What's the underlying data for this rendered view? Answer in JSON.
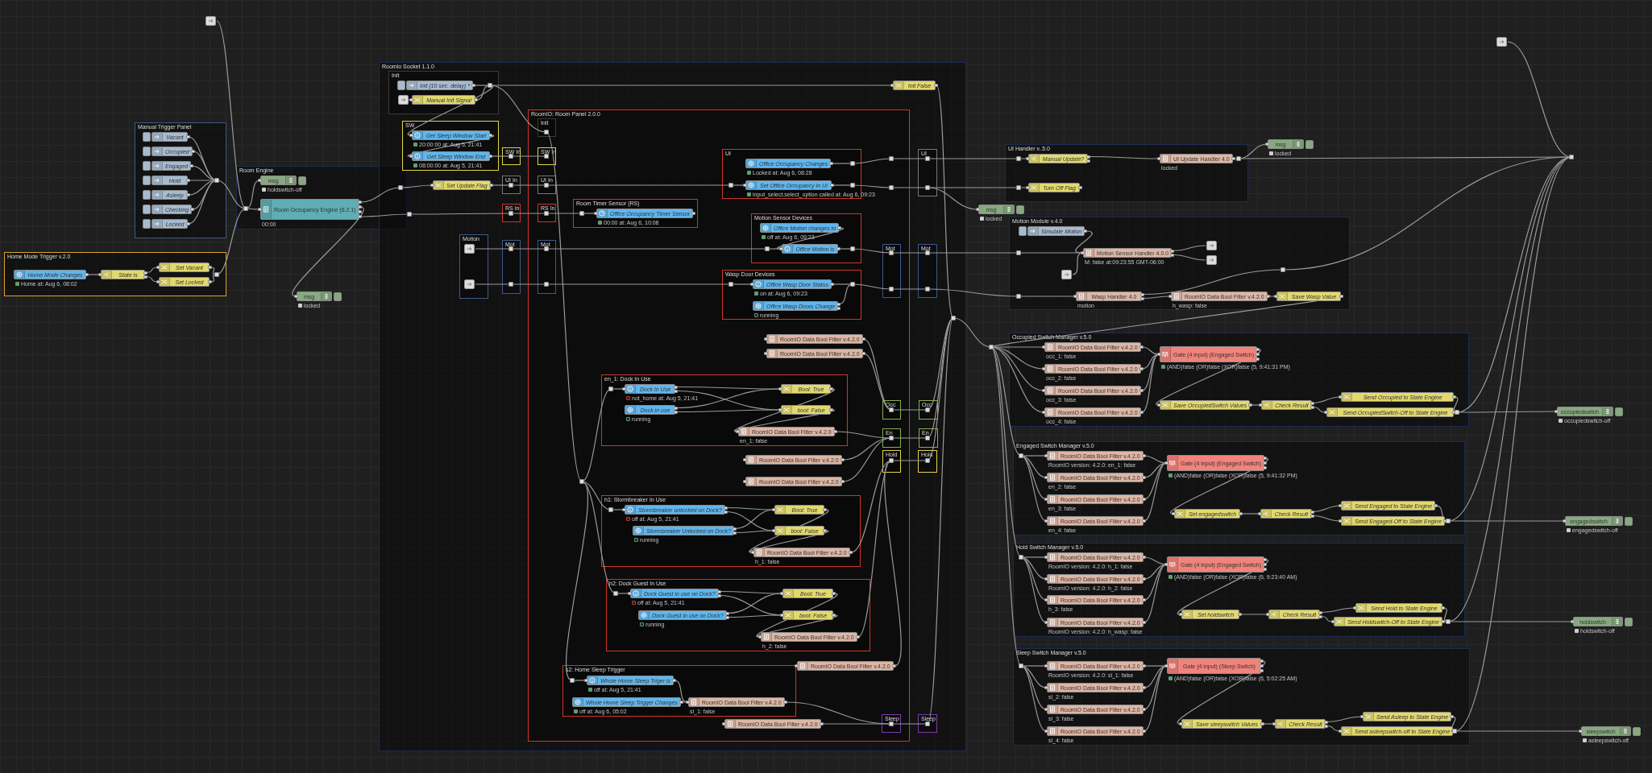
{
  "flow": {
    "nodes": [
      {
        "kind": "debug",
        "label": "msg",
        "status": {
          "text": "locked",
          "color": "#cccccc",
          "hollow": false
        }
      },
      {
        "kind": "debug",
        "label": "msg",
        "status": {
          "text": "locked",
          "color": "#cccccc",
          "hollow": false
        }
      },
      {
        "kind": "debug",
        "label": "msg",
        "status": {
          "text": "locked",
          "color": "#cccccc",
          "hollow": false
        }
      },
      {
        "kind": "debug",
        "label": "occupiedswitch",
        "status": {
          "text": "occupiedswitch-off",
          "color": "#cccccc",
          "hollow": false
        }
      },
      {
        "kind": "debug",
        "label": "engagedswitch",
        "status": {
          "text": "engagedswitch-off",
          "color": "#cccccc",
          "hollow": false
        }
      },
      {
        "kind": "debug",
        "label": "holdswitch",
        "status": {
          "text": "holdswitch-off",
          "color": "#cccccc",
          "hollow": false
        }
      },
      {
        "kind": "debug",
        "label": "sleepswitch",
        "status": {
          "text": "asleepswitch-off",
          "color": "#cccccc",
          "hollow": false
        }
      }
    ],
    "groups": [
      {
        "title": "Manual Trigger Panel",
        "color": "#3d5a8a",
        "nodes": [
          {
            "kind": "inject",
            "label": "Vacant"
          },
          {
            "kind": "inject",
            "label": "Occupied"
          },
          {
            "kind": "inject",
            "label": "Engaged"
          },
          {
            "kind": "inject",
            "label": "Hold"
          },
          {
            "kind": "inject",
            "label": "Asleep"
          },
          {
            "kind": "inject",
            "label": "Checking"
          },
          {
            "kind": "inject",
            "label": "Locked"
          }
        ]
      },
      {
        "title": "Home Mode Trigger v.2.0",
        "color": "#d9a52a",
        "nodes": [
          {
            "kind": "ha-event",
            "label": "Home Mode Changes",
            "status": {
              "text": "Home at: Aug 6, 08:02",
              "color": "#5aa06e",
              "hollow": false
            }
          },
          {
            "kind": "switch",
            "label": "State is"
          },
          {
            "kind": "change",
            "label": "Set Vacant"
          },
          {
            "kind": "change",
            "label": "Set Locked"
          }
        ]
      },
      {
        "title": "Room Engine",
        "color": "#1d2b4f",
        "nodes": [
          {
            "kind": "debug",
            "label": "msg",
            "status": {
              "text": "holdswitch-off",
              "color": "#cccccc",
              "hollow": false
            }
          },
          {
            "kind": "engine",
            "label": "Room Occupancy Engine (6.2.1)",
            "status": {
              "text": "00:00"
            }
          }
        ]
      },
      {
        "title": "Roomio Socket 1.1.0",
        "color": "#1d2b55",
        "nodes": [
          {
            "kind": "change",
            "label": "Set Update Flag"
          },
          {
            "kind": "change",
            "label": "Init False"
          }
        ],
        "groups": [
          {
            "title": "Init",
            "color": "#3a3a3a",
            "nodes": [
              {
                "kind": "inject",
                "label": "Init (10 sec. delay) *"
              },
              {
                "kind": "change",
                "label": "Manual Init Signal"
              }
            ]
          },
          {
            "title": "SW",
            "color": "#e2d64a",
            "nodes": [
              {
                "kind": "ha-state",
                "label": "Get Sleep Window Start",
                "status": {
                  "text": "20:00:00 at: Aug 5, 21:41",
                  "color": "#5aa06e",
                  "hollow": false
                }
              },
              {
                "kind": "ha-state",
                "label": "Get Sleep Window End",
                "status": {
                  "text": "08:00:00 at: Aug 5, 21:41",
                  "color": "#5aa06e",
                  "hollow": false
                }
              }
            ]
          },
          {
            "title": "SW In",
            "color": "#e2d64a"
          },
          {
            "title": "UI In",
            "color": "#777777"
          },
          {
            "title": "RS In",
            "color": "#d0342a"
          },
          {
            "title": "Motion",
            "color": "#3d5a8a"
          },
          {
            "title": "Mot",
            "color": "#3d5a8a"
          },
          {
            "title": "RoomIO: Room Panel 2.0.0",
            "color": "#d0342a",
            "nodes": [
              {
                "kind": "function",
                "label": "RoomIO Data Bool Filter v.4.2.0"
              },
              {
                "kind": "function",
                "label": "RoomIO Data Bool Filter v.4.2.0"
              },
              {
                "kind": "function",
                "label": "RoomIO Data Bool Filter v.4.2.0"
              },
              {
                "kind": "function",
                "label": "RoomIO Data Bool Filter v.4.2.0"
              },
              {
                "kind": "function",
                "label": "RoomIO Data Bool Filter v.4.2.0"
              },
              {
                "kind": "function",
                "label": "RoomIO Data Bool Filter v.4.2.0"
              }
            ],
            "groups": [
              {
                "title": "Init",
                "color": "#3a3a3a"
              },
              {
                "title": "SW In",
                "color": "#e2d64a"
              },
              {
                "title": "UI In",
                "color": "#777777"
              },
              {
                "title": "RS In",
                "color": "#d0342a"
              },
              {
                "title": "Mot",
                "color": "#3d5a8a"
              },
              {
                "title": "UI",
                "color": "#d0342a",
                "nodes": [
                  {
                    "kind": "ha-event",
                    "label": "Office Occupancy Changes",
                    "status": {
                      "text": "Locked at: Aug 6, 08:28",
                      "color": "#5aa06e",
                      "hollow": false
                    }
                  },
                  {
                    "kind": "ha-action",
                    "label": "Set Office Occupancy in UI",
                    "status": {
                      "text": "input_select.select_option called at: Aug 6, 09:23",
                      "color": "#5aa06e",
                      "hollow": false
                    }
                  }
                ]
              },
              {
                "title": "Room Timer Sensor (RS)",
                "color": "#d0342a",
                "nodes": [
                  {
                    "kind": "ha-timer",
                    "label": "Office Occupancy Timer Sensor",
                    "status": {
                      "text": "00:00 at: Aug 6, 10:08",
                      "color": "#5aa06e",
                      "hollow": false
                    }
                  }
                ]
              },
              {
                "title": "Motion Sensor Devices",
                "color": "#d0342a",
                "nodes": [
                  {
                    "kind": "ha-event",
                    "label": "Office Motion changes to",
                    "status": {
                      "text": "off at: Aug 6, 09:23",
                      "color": "#5aa06e",
                      "hollow": false
                    }
                  },
                  {
                    "kind": "ha-state",
                    "label": "Office Motion is"
                  }
                ]
              },
              {
                "title": "Wasp Door Devices",
                "color": "#d0342a",
                "nodes": [
                  {
                    "kind": "ha-state",
                    "label": "Office Wasp Door Status",
                    "status": {
                      "text": "on at: Aug 6, 09:23",
                      "color": "#5aa06e",
                      "hollow": false
                    }
                  },
                  {
                    "kind": "ha-event",
                    "label": "Office Wasp Doors Change",
                    "status": {
                      "text": "running",
                      "color": "#5aa06e",
                      "hollow": true
                    }
                  }
                ]
              },
              {
                "title": "en_1: Dock In Use",
                "color": "#d0342a",
                "nodes": [
                  {
                    "kind": "ha-state",
                    "label": "Dock In Use",
                    "status": {
                      "text": "not_home at: Aug 5, 21:41",
                      "color": "#c8342c",
                      "hollow": true
                    }
                  },
                  {
                    "kind": "ha-event",
                    "label": "Dock in use",
                    "status": {
                      "text": "running",
                      "color": "#5aa06e",
                      "hollow": true
                    }
                  },
                  {
                    "kind": "change",
                    "label": "Bool: True"
                  },
                  {
                    "kind": "change",
                    "label": "bool: False"
                  },
                  {
                    "kind": "function",
                    "label": "RoomIO Data Bool Filter v.4.2.0",
                    "status": {
                      "text": "en_1: false"
                    }
                  }
                ]
              },
              {
                "title": "h1: Stormbreaker In Use",
                "color": "#d0342a",
                "nodes": [
                  {
                    "kind": "ha-state",
                    "label": "Stormbreaker unlocked on Dock?",
                    "status": {
                      "text": "off at: Aug 5, 21:41",
                      "color": "#c8342c",
                      "hollow": true
                    }
                  },
                  {
                    "kind": "ha-event",
                    "label": "Stormbreaker Unlocked on Dock?",
                    "status": {
                      "text": "running",
                      "color": "#5aa06e",
                      "hollow": true
                    }
                  },
                  {
                    "kind": "change",
                    "label": "Bool: True"
                  },
                  {
                    "kind": "change",
                    "label": "bool: False"
                  },
                  {
                    "kind": "function",
                    "label": "RoomIO Data Bool Filter v.4.2.0",
                    "status": {
                      "text": "h_1: false"
                    }
                  }
                ]
              },
              {
                "title": "h2: Dock Guest In Use",
                "color": "#d0342a",
                "nodes": [
                  {
                    "kind": "ha-state",
                    "label": "Dock Guest in use on Dock?",
                    "status": {
                      "text": "off at: Aug 5, 21:41",
                      "color": "#c8342c",
                      "hollow": true
                    }
                  },
                  {
                    "kind": "ha-event",
                    "label": "Dock Guest in use on Dock?",
                    "status": {
                      "text": "running",
                      "color": "#5aa06e",
                      "hollow": true
                    }
                  },
                  {
                    "kind": "change",
                    "label": "Bool: True"
                  },
                  {
                    "kind": "change",
                    "label": "bool: False"
                  },
                  {
                    "kind": "function",
                    "label": "RoomIO Data Bool Filter v.4.2.0",
                    "status": {
                      "text": "h_2: false"
                    }
                  }
                ]
              },
              {
                "title": "s2: Home Sleep Trigger",
                "color": "#d0342a",
                "nodes": [
                  {
                    "kind": "ha-state",
                    "label": "Whole Home Sleep Triger is",
                    "status": {
                      "text": "off at: Aug 5, 21:41",
                      "color": "#5aa06e",
                      "hollow": false
                    }
                  },
                  {
                    "kind": "ha-event",
                    "label": "Whole Home Sleep Trigger Changes",
                    "status": {
                      "text": "off at: Aug 6, 05:02",
                      "color": "#5aa06e",
                      "hollow": false
                    }
                  },
                  {
                    "kind": "function",
                    "label": "RoomIO Data Bool Filter v.4.2.0",
                    "status": {
                      "text": "sl_1: false"
                    }
                  }
                ]
              },
              {
                "title": "Mot",
                "color": "#3d5a8a"
              },
              {
                "title": "Occ",
                "color": "#8ab04a"
              },
              {
                "title": "En",
                "color": "#8ab04a"
              },
              {
                "title": "Hold",
                "color": "#e2d64a"
              },
              {
                "title": "Sleep",
                "color": "#7a3cb0"
              }
            ]
          },
          {
            "title": "UI",
            "color": "#777777"
          },
          {
            "title": "Mot",
            "color": "#3d5a8a"
          },
          {
            "title": "Occ",
            "color": "#8ab04a"
          },
          {
            "title": "En",
            "color": "#8ab04a"
          },
          {
            "title": "Hold",
            "color": "#e2d64a"
          },
          {
            "title": "Sleep",
            "color": "#7a3cb0"
          }
        ]
      },
      {
        "title": "UI Handler v..5.0",
        "color": "#1d2b55",
        "nodes": [
          {
            "kind": "switch",
            "label": "Manual Update?"
          },
          {
            "kind": "function",
            "label": "UI Update Handler 4.0",
            "status": {
              "text": "locked"
            }
          },
          {
            "kind": "change",
            "label": "Turn Off Flag"
          }
        ]
      },
      {
        "title": "Motion Module v.4.0",
        "color": "#1d2b55",
        "nodes": [
          {
            "kind": "inject",
            "label": "Simulate Motion"
          },
          {
            "kind": "function",
            "label": "Motion Sensor Handler 4.0.0",
            "status": {
              "text": "M: false at:09:23:55 GMT-06:00"
            }
          },
          {
            "kind": "function",
            "label": "Wasp Handler 4.0",
            "status": {
              "text": "motion"
            }
          },
          {
            "kind": "function",
            "label": "RoomIO Data Bool Filter v.4.2.0",
            "status": {
              "text": "h_wasp: false"
            }
          },
          {
            "kind": "change",
            "label": "Save Wasp Value"
          }
        ]
      },
      {
        "title": "Occupied Switch Manager v.5.0",
        "color": "#1d2b55",
        "nodes": [
          {
            "kind": "function",
            "label": "RoomIO Data Bool Filter v.4.2.0",
            "status": {
              "text": "occ_1: false"
            }
          },
          {
            "kind": "function",
            "label": "RoomIO Data Bool Filter v.4.2.0",
            "status": {
              "text": "occ_2: false"
            }
          },
          {
            "kind": "function",
            "label": "RoomIO Data Bool Filter v.4.2.0",
            "status": {
              "text": "occ_3: false"
            }
          },
          {
            "kind": "function",
            "label": "RoomIO Data Bool Filter v.4.2.0",
            "status": {
              "text": "occ_4: false"
            }
          },
          {
            "kind": "gate",
            "label": "Gate (4 input) (Engaged Switch)",
            "status": {
              "text": "(AND)false (OR)false (XOR)false (5, 9:41:31 PM)",
              "color": "#5aa06e",
              "hollow": false
            }
          },
          {
            "kind": "change",
            "label": "Save OccupiedSwitch Values"
          },
          {
            "kind": "switch",
            "label": "Check Result"
          },
          {
            "kind": "change",
            "label": "Send Occupied to State Engine"
          },
          {
            "kind": "change",
            "label": "Send OccupiedSwitch-Off to State Engine"
          }
        ]
      },
      {
        "title": "Engaged Switch Manager v.5.0",
        "color": "#1d2b55",
        "nodes": [
          {
            "kind": "function",
            "label": "RoomIO Data Bool Filter v.4.2.0",
            "status": {
              "text": "RoomIO version: 4.2.0: en_1: false"
            }
          },
          {
            "kind": "function",
            "label": "RoomIO Data Bool Filter v.4.2.0",
            "status": {
              "text": "en_2: false"
            }
          },
          {
            "kind": "function",
            "label": "RoomIO Data Bool Filter v.4.2.0",
            "status": {
              "text": "en_3: false"
            }
          },
          {
            "kind": "function",
            "label": "RoomIO Data Bool Filter v.4.2.0",
            "status": {
              "text": "en_4: false"
            }
          },
          {
            "kind": "gate",
            "label": "Gate (4 input) (Engaged Switch)",
            "status": {
              "text": "(AND)false (OR)false (XOR)false (5, 9:41:32 PM)",
              "color": "#5aa06e",
              "hollow": false
            }
          },
          {
            "kind": "change",
            "label": "Set engagedswitch"
          },
          {
            "kind": "switch",
            "label": "Check Result"
          },
          {
            "kind": "change",
            "label": "Send Engaged to State Engine"
          },
          {
            "kind": "change",
            "label": "Send Engaged-Off to State Engine"
          }
        ]
      },
      {
        "title": "Hold Switch Manager v.5.0",
        "color": "#1d2b55",
        "nodes": [
          {
            "kind": "function",
            "label": "RoomIO Data Bool Filter v.4.2.0",
            "status": {
              "text": "RoomIO version: 4.2.0: h_1: false"
            }
          },
          {
            "kind": "function",
            "label": "RoomIO Data Bool Filter v.4.2.0",
            "status": {
              "text": "RoomIO version: 4.2.0: h_2: false"
            }
          },
          {
            "kind": "function",
            "label": "RoomIO Data Bool Filter v.4.2.0",
            "status": {
              "text": "h_3: false"
            }
          },
          {
            "kind": "function",
            "label": "RoomIO Data Bool Filter v.4.2.0",
            "status": {
              "text": "RoomIO version: 4.2.0: h_wasp: false"
            }
          },
          {
            "kind": "gate",
            "label": "Gate (4 input) (Engaged Switch)",
            "status": {
              "text": "(AND)false (OR)false (XOR)false (6, 9:23:40 AM)",
              "color": "#5aa06e",
              "hollow": false
            }
          },
          {
            "kind": "change",
            "label": "Set holdswitch"
          },
          {
            "kind": "switch",
            "label": "Check Result"
          },
          {
            "kind": "change",
            "label": "Send Hold to State Engine"
          },
          {
            "kind": "change",
            "label": "Send Holdswitch-Off to State Engine"
          }
        ]
      },
      {
        "title": "Sleep Switch Manager v.5.0",
        "color": "#1d2b55",
        "nodes": [
          {
            "kind": "function",
            "label": "RoomIO Data Bool Filter v.4.2.0",
            "status": {
              "text": "RoomIO version: 4.2.0: sl_1: false"
            }
          },
          {
            "kind": "function",
            "label": "RoomIO Data Bool Filter v.4.2.0",
            "status": {
              "text": "sl_2: false"
            }
          },
          {
            "kind": "function",
            "label": "RoomIO Data Bool Filter v.4.2.0",
            "status": {
              "text": "sl_3: false"
            }
          },
          {
            "kind": "function",
            "label": "RoomIO Data Bool Filter v.4.2.0",
            "status": {
              "text": "sl_4: false"
            }
          },
          {
            "kind": "gate",
            "label": "Gate (4 input) (Sleep Switch)",
            "status": {
              "text": "(AND)false (OR)false (XOR)false (6, 5:02:25 AM)",
              "color": "#5aa06e",
              "hollow": false
            }
          },
          {
            "kind": "change",
            "label": "Save sleepswitch Values"
          },
          {
            "kind": "switch",
            "label": "Check Result"
          },
          {
            "kind": "change",
            "label": "Send Asleep to State Engine"
          },
          {
            "kind": "change",
            "label": "Send asleepswitch-off to State Engine"
          }
        ]
      }
    ]
  }
}
